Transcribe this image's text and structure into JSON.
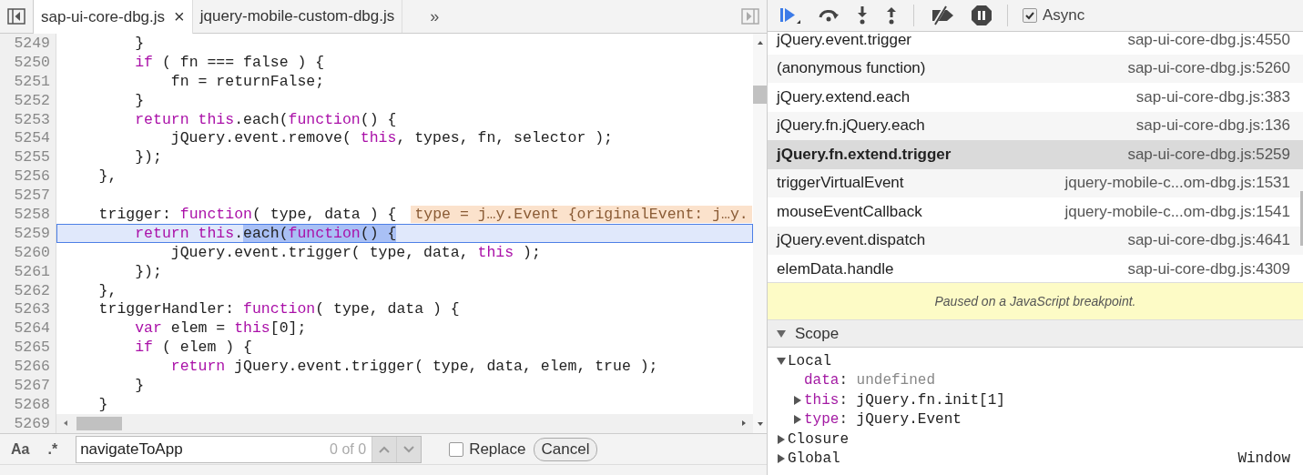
{
  "editor": {
    "tabs": [
      {
        "label": "sap-ui-core-dbg.js",
        "selected": true,
        "close": "×"
      },
      {
        "label": "jquery-mobile-custom-dbg.js",
        "selected": false
      }
    ],
    "overflow": "»",
    "lines": [
      {
        "number": "5249",
        "current": false,
        "tokens": [
          {
            "kind": "plain",
            "text": "        }"
          }
        ]
      },
      {
        "number": "5250",
        "current": false,
        "tokens": [
          {
            "kind": "keyword",
            "text": "        if"
          },
          {
            "kind": "plain",
            "text": " ( fn === false ) {"
          }
        ]
      },
      {
        "number": "5251",
        "current": false,
        "tokens": [
          {
            "kind": "plain",
            "text": "            fn = returnFalse;"
          }
        ]
      },
      {
        "number": "5252",
        "current": false,
        "tokens": [
          {
            "kind": "plain",
            "text": "        }"
          }
        ]
      },
      {
        "number": "5253",
        "current": false,
        "tokens": [
          {
            "kind": "keyword",
            "text": "        return this"
          },
          {
            "kind": "plain",
            "text": ".each("
          },
          {
            "kind": "keyword",
            "text": "function"
          },
          {
            "kind": "plain",
            "text": "() {"
          }
        ]
      },
      {
        "number": "5254",
        "current": false,
        "tokens": [
          {
            "kind": "plain",
            "text": "            jQuery.event.remove( "
          },
          {
            "kind": "keyword",
            "text": "this"
          },
          {
            "kind": "plain",
            "text": ", types, fn, selector );"
          }
        ]
      },
      {
        "number": "5255",
        "current": false,
        "tokens": [
          {
            "kind": "plain",
            "text": "        });"
          }
        ]
      },
      {
        "number": "5256",
        "current": false,
        "tokens": [
          {
            "kind": "plain",
            "text": "    },"
          }
        ]
      },
      {
        "number": "5257",
        "current": false
      },
      {
        "number": "5258",
        "current": false,
        "tokens": [
          {
            "kind": "plain",
            "text": "    trigger: "
          },
          {
            "kind": "keyword",
            "text": "function"
          },
          {
            "kind": "plain",
            "text": "( type, data ) {"
          }
        ],
        "inline_value": "type = j…y.Event {originalEvent: j…y."
      },
      {
        "number": "5259",
        "current": true,
        "tokens": [
          {
            "kind": "keyword",
            "text": "        return this"
          },
          {
            "kind": "plain",
            "text": "."
          },
          {
            "kind": "selected-plain",
            "text": "each("
          },
          {
            "kind": "selected-keyword",
            "text": "function"
          },
          {
            "kind": "selected-plain",
            "text": "() {"
          }
        ]
      },
      {
        "number": "5260",
        "current": false,
        "tokens": [
          {
            "kind": "plain",
            "text": "            jQuery.event.trigger( type, data, "
          },
          {
            "kind": "keyword",
            "text": "this"
          },
          {
            "kind": "plain",
            "text": " );"
          }
        ]
      },
      {
        "number": "5261",
        "current": false,
        "tokens": [
          {
            "kind": "plain",
            "text": "        });"
          }
        ]
      },
      {
        "number": "5262",
        "current": false,
        "tokens": [
          {
            "kind": "plain",
            "text": "    },"
          }
        ]
      },
      {
        "number": "5263",
        "current": false,
        "tokens": [
          {
            "kind": "plain",
            "text": "    triggerHandler: "
          },
          {
            "kind": "keyword",
            "text": "function"
          },
          {
            "kind": "plain",
            "text": "( type, data ) {"
          }
        ]
      },
      {
        "number": "5264",
        "current": false,
        "tokens": [
          {
            "kind": "keyword",
            "text": "        var"
          },
          {
            "kind": "plain",
            "text": " elem = "
          },
          {
            "kind": "keyword",
            "text": "this"
          },
          {
            "kind": "plain",
            "text": "[0];"
          }
        ]
      },
      {
        "number": "5265",
        "current": false,
        "tokens": [
          {
            "kind": "keyword",
            "text": "        if"
          },
          {
            "kind": "plain",
            "text": " ( elem ) {"
          }
        ]
      },
      {
        "number": "5266",
        "current": false,
        "tokens": [
          {
            "kind": "keyword",
            "text": "            return"
          },
          {
            "kind": "plain",
            "text": " jQuery.event.trigger( type, data, elem, true );"
          }
        ]
      },
      {
        "number": "5267",
        "current": false,
        "tokens": [
          {
            "kind": "plain",
            "text": "        }"
          }
        ]
      },
      {
        "number": "5268",
        "current": false,
        "tokens": [
          {
            "kind": "plain",
            "text": "    }"
          }
        ]
      }
    ],
    "last_line_number": "5269",
    "search": {
      "case_toggle": "Aa",
      "regex_toggle": ".*",
      "value": "navigateToApp",
      "count": "0 of 0",
      "replace": {
        "label": "Replace",
        "checked": false
      },
      "cancel": "Cancel"
    }
  },
  "debugger": {
    "async": {
      "label": "Async",
      "checked": true
    },
    "call_stack": [
      {
        "name": "jQuery.event.trigger",
        "location": "sap-ui-core-dbg.js:4550",
        "selected": false
      },
      {
        "name": "(anonymous function)",
        "location": "sap-ui-core-dbg.js:5260",
        "selected": false
      },
      {
        "name": "jQuery.extend.each",
        "location": "sap-ui-core-dbg.js:383",
        "selected": false
      },
      {
        "name": "jQuery.fn.jQuery.each",
        "location": "sap-ui-core-dbg.js:136",
        "selected": false
      },
      {
        "name": "jQuery.fn.extend.trigger",
        "location": "sap-ui-core-dbg.js:5259",
        "selected": true
      },
      {
        "name": "triggerVirtualEvent",
        "location": "jquery-mobile-c...om-dbg.js:1531",
        "selected": false
      },
      {
        "name": "mouseEventCallback",
        "location": "jquery-mobile-c...om-dbg.js:1541",
        "selected": false
      },
      {
        "name": "jQuery.event.dispatch",
        "location": "sap-ui-core-dbg.js:4641",
        "selected": false
      },
      {
        "name": "elemData.handle",
        "location": "sap-ui-core-dbg.js:4309",
        "selected": false
      }
    ],
    "paused_message": "Paused on a JavaScript breakpoint.",
    "scope": {
      "title": "Scope",
      "expanded": true,
      "items": [
        {
          "name": "Local",
          "expanded": true,
          "children": [
            {
              "name": "data",
              "separator": ":",
              "kind": "primitive",
              "value": "undefined"
            },
            {
              "name": "this",
              "separator": ":",
              "kind": "object",
              "expanded": false,
              "value": "jQuery.fn.init[1]"
            },
            {
              "name": "type",
              "separator": ":",
              "kind": "object",
              "expanded": false,
              "value": "jQuery.Event"
            }
          ]
        },
        {
          "name": "Closure",
          "expanded": false
        },
        {
          "name": "Global",
          "expanded": false,
          "value": "Window"
        }
      ]
    }
  }
}
